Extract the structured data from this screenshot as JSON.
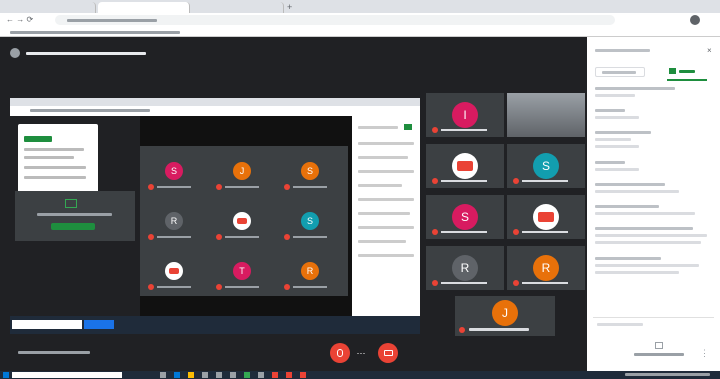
{
  "colors": {
    "accent_red": "#ea4335",
    "meet_bg": "#202124",
    "tile_bg": "#3c4043",
    "green": "#34a853",
    "orange": "#e8710a",
    "pink": "#d81b60",
    "purple": "#5f6368"
  },
  "browser": {
    "tabs_count": 3
  },
  "share_tiles": [
    {
      "initial": "S",
      "color": "#d81b60"
    },
    {
      "initial": "J",
      "color": "#e8710a"
    },
    {
      "initial": "S",
      "color": "#e8710a"
    },
    {
      "initial": "R",
      "color": "#5f6368"
    },
    {
      "initial": "",
      "color": "#ffffff",
      "logo": true
    },
    {
      "initial": "S",
      "color": "#129eaf"
    },
    {
      "initial": "",
      "color": "#ffffff",
      "logo": true
    },
    {
      "initial": "T",
      "color": "#d81b60"
    },
    {
      "initial": "R",
      "color": "#e8710a"
    }
  ],
  "grid_tiles": [
    {
      "initial": "I",
      "color": "#d81b60"
    },
    {
      "initial": "",
      "color": "#888",
      "video": true
    },
    {
      "initial": "",
      "color": "#ffffff",
      "logo": true
    },
    {
      "initial": "S",
      "color": "#129eaf"
    },
    {
      "initial": "S",
      "color": "#d81b60"
    },
    {
      "initial": "",
      "color": "#ffffff",
      "logo": true
    },
    {
      "initial": "R",
      "color": "#5f6368"
    },
    {
      "initial": "R",
      "color": "#e8710a"
    }
  ],
  "self_tile": {
    "initial": "J",
    "color": "#e8710a"
  }
}
